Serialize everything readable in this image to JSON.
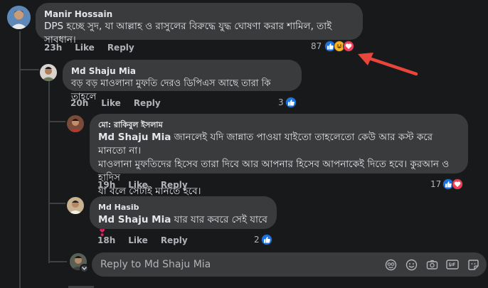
{
  "comments": [
    {
      "author": "Manir Hossain",
      "text": "DPS হচ্ছে সুদ, যা আল্লাহ ও রাসুলের বিরুদ্ধে যুদ্ধ ঘোষণা করার শামিল, তাই সাবধান।",
      "time": "23h",
      "like": "Like",
      "reply": "Reply",
      "reactions": "87"
    },
    {
      "author": "Md Shaju Mia",
      "text": "বড় বড় মাওলানা মুফতি দেরও ডিপিএস আছে তারা কি তাহলে",
      "time": "20h",
      "like": "Like",
      "reply": "Reply",
      "reactions": "3"
    },
    {
      "author": "মো: রাকিবুল ইসলাম",
      "mention": "Md Shaju Mia",
      "text1": " জানলেই যদি জান্নাত পাওয়া যাইতো তাহলেতো কেউ আর কস্ট করে মানতো না।",
      "text2": "মাওলানা মুফতিদের হিসেব তারা দিবে আর আপনার হিসেব আপনাকেই দিতে হবে। কুরআন ও হাদিস",
      "text3": "যা বলে সেটাই মানতে হবে।",
      "time": "19h",
      "like": "Like",
      "reply": "Reply",
      "reactions": "17"
    },
    {
      "author": "Md Hasib",
      "mention": "Md Shaju Mia",
      "text": " যার যার কবরে সেই যাবে",
      "emoji": "❣",
      "time": "18h",
      "like": "Like",
      "reply": "Reply",
      "reactions": "2"
    }
  ],
  "reply_box": {
    "placeholder": "Reply to Md Shaju Mia"
  },
  "colors": {
    "accent": "#1b74e4",
    "heart": "#f33e58",
    "arrow": "#e8453c"
  }
}
